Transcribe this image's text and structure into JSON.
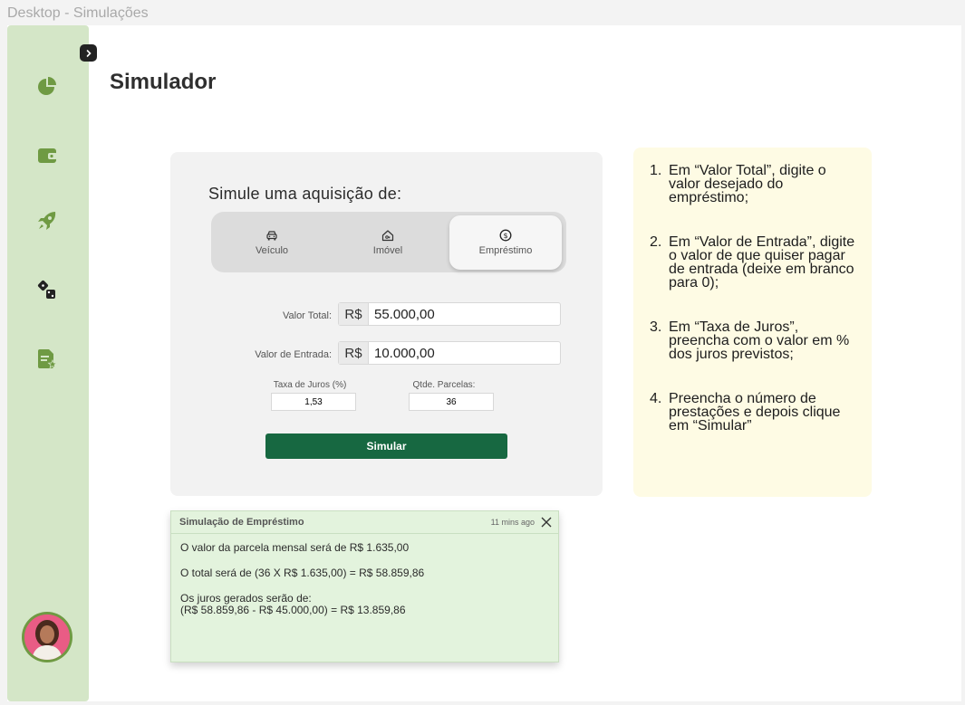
{
  "window": {
    "title": "Desktop - Simulações"
  },
  "page": {
    "title": "Simulador"
  },
  "sidebar": {
    "collapse_icon": "chevron-right-icon",
    "items": [
      {
        "icon": "pie-chart-icon"
      },
      {
        "icon": "wallet-icon"
      },
      {
        "icon": "rocket-icon"
      },
      {
        "icon": "dice-icon"
      },
      {
        "icon": "document-star-icon"
      }
    ],
    "accent_color": "#6f9a43",
    "background_color": "#d4e6c7"
  },
  "simulator": {
    "heading": "Simule uma aquisição de:",
    "options": [
      {
        "label": "Veículo",
        "icon": "car-icon"
      },
      {
        "label": "Imóvel",
        "icon": "house-icon"
      },
      {
        "label": "Empréstimo",
        "icon": "dollar-coin-icon"
      }
    ],
    "selected_option": "Empréstimo",
    "total_value": {
      "label": "Valor Total:",
      "prefix": "R$",
      "value": "55.000,00"
    },
    "down_payment": {
      "label": "Valor de Entrada:",
      "prefix": "R$",
      "value": "10.000,00"
    },
    "interest_rate": {
      "label": "Taxa de Juros (%)",
      "value": "1,53"
    },
    "installments": {
      "label": "Qtde. Parcelas:",
      "value": "36"
    },
    "button_label": "Simular",
    "button_color": "#176841"
  },
  "help": {
    "items": [
      {
        "number": "1.",
        "text": "Em “Valor Total”, digite o valor desejado do empréstimo;"
      },
      {
        "number": "2.",
        "text": "Em “Valor de Entrada”, digite o valor de que quiser pagar de entrada (deixe em branco para 0);"
      },
      {
        "number": "3.",
        "text": "Em “Taxa de Juros”, preencha com o valor em % dos juros previstos;"
      },
      {
        "number": "4.",
        "text": "Preencha o número de prestações e depois clique em “Simular”"
      }
    ]
  },
  "result": {
    "title": "Simulação de Empréstimo",
    "time": "11 mins ago",
    "line1": "O valor da parcela mensal será de R$ 1.635,00",
    "line2": "O total será de (36 X R$ 1.635,00) = R$ 58.859,86",
    "line3": "Os juros gerados serão de:",
    "line4": "(R$ 58.859,86 - R$ 45.000,00) =  R$ 13.859,86"
  }
}
